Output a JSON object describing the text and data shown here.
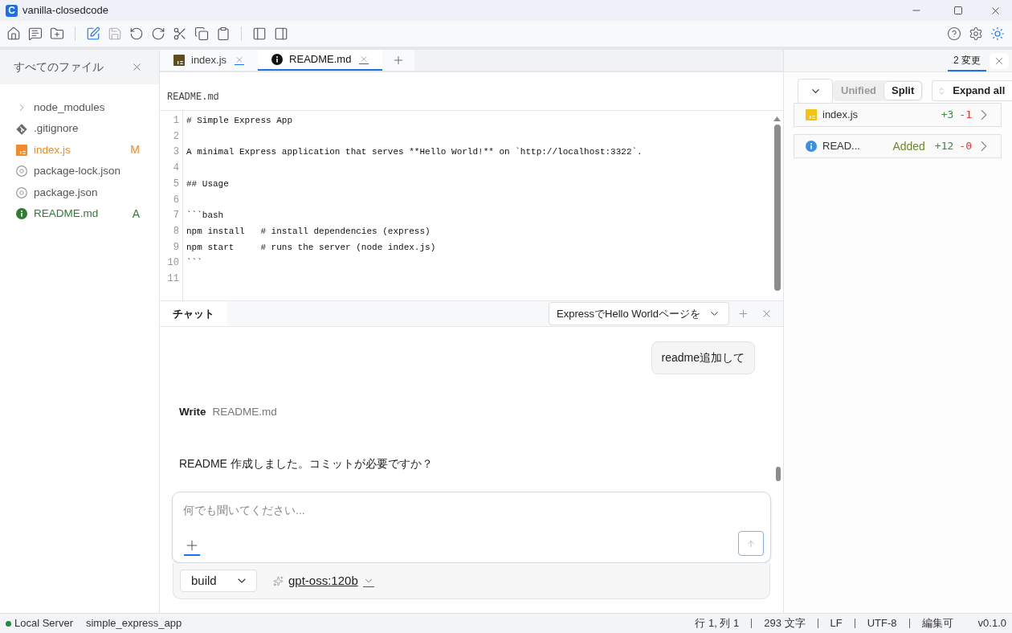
{
  "window": {
    "logo": "C",
    "title": "vanilla-closedcode"
  },
  "toolbar": {
    "edit": {
      "on": true
    },
    "save": {
      "disabled": true
    }
  },
  "sidebar": {
    "title": "すべてのファイル",
    "items": [
      {
        "name": "node_modules",
        "kind": "folder",
        "expanded": false
      },
      {
        "name": ".gitignore",
        "kind": "git"
      },
      {
        "name": "index.js",
        "kind": "js",
        "status": "M",
        "color": "#f28b2c"
      },
      {
        "name": "package-lock.json",
        "kind": "json"
      },
      {
        "name": "package.json",
        "kind": "json"
      },
      {
        "name": "README.md",
        "kind": "info",
        "status": "A",
        "color": "#2e7d32"
      }
    ]
  },
  "editor": {
    "tabs": [
      {
        "label": "index.js",
        "kind": "js",
        "selected": false
      },
      {
        "label": "README.md",
        "kind": "info",
        "selected": true
      }
    ],
    "breadcrumb": "README.md",
    "lines": [
      {
        "number": "1",
        "text": "# Simple Express App"
      },
      {
        "number": "2"
      },
      {
        "number": "3",
        "text": "A minimal Express application that serves **Hello World!** on `http://localhost:3322`."
      },
      {
        "number": "4"
      },
      {
        "number": "5",
        "text": "## Usage"
      },
      {
        "number": "6"
      },
      {
        "number": "7",
        "text": "```bash"
      },
      {
        "number": "8",
        "text": "npm install   # install dependencies (express)"
      },
      {
        "number": "9",
        "text": "npm start     # runs the server (node index.js)"
      },
      {
        "number": "10",
        "text": "```"
      },
      {
        "number": "11"
      }
    ]
  },
  "chat": {
    "tab": "チャット",
    "session": "ExpressでHello Worldページを",
    "messages": [
      {
        "kind": "user",
        "text": "readme追加して"
      },
      {
        "kind": "tool",
        "action": "Write",
        "target": "README.md"
      },
      {
        "kind": "assistant",
        "text": "README 作成しました。コミットが必要ですか？"
      }
    ],
    "input": {
      "placeholder": "何でも聞いてください..."
    },
    "mode": "build",
    "model": "gpt-oss:120b"
  },
  "changes": {
    "tab": {
      "label": "2 変更",
      "selected": true
    },
    "view_options": [
      {
        "label": "Unified",
        "selected": false
      },
      {
        "label": "Split",
        "selected": true
      }
    ],
    "expand": "Expand all",
    "files": [
      {
        "name": "index.js",
        "kind": "js",
        "additions": "+3",
        "deletions": "-1"
      },
      {
        "name": "READ...",
        "kind": "info",
        "badge": "Added",
        "additions": "+12",
        "deletions": "-0"
      }
    ]
  },
  "status_bar": {
    "server": {
      "label": "Local Server",
      "connected": true
    },
    "project": "simple_express_app",
    "items": [
      "行 1, 列 1",
      "293 文字",
      "LF",
      "UTF-8",
      "編集可"
    ],
    "version": "v0.1.0"
  }
}
